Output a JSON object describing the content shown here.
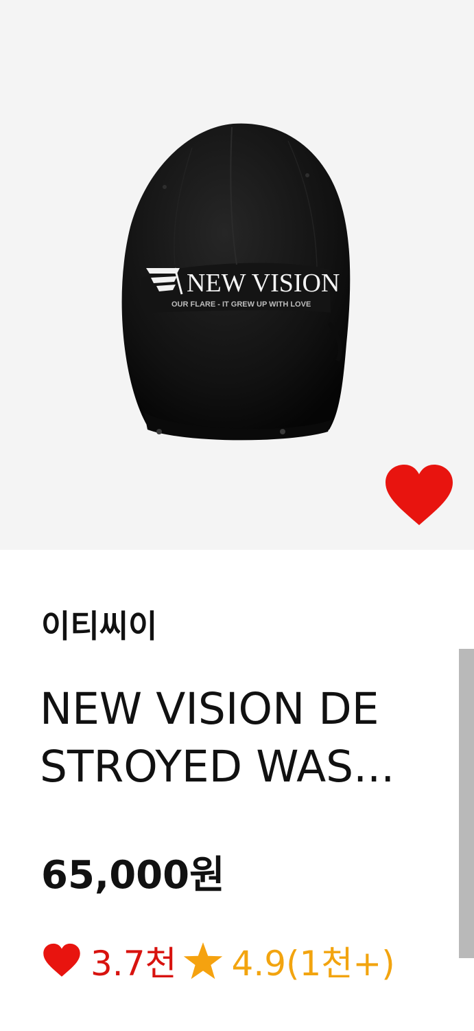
{
  "product": {
    "brand": "이티씨이",
    "title_line1": "NEW VISION DE",
    "title_line2": "STROYED WAS...",
    "price": "65,000원",
    "likes": "3.7천",
    "rating": "4.9(1천+)"
  },
  "image": {
    "cap_logo_text": "NEW VISION",
    "cap_subtext": "OUR FLARE - IT GREW UP WITH LOVE"
  },
  "colors": {
    "heart": "#e8140f",
    "likes_text": "#d8130f",
    "star": "#f5a20f",
    "rating_text": "#f2a40f",
    "image_bg": "#f4f4f4"
  },
  "icons": {
    "favorite": "heart-icon",
    "likes": "heart-icon",
    "rating": "star-icon"
  }
}
